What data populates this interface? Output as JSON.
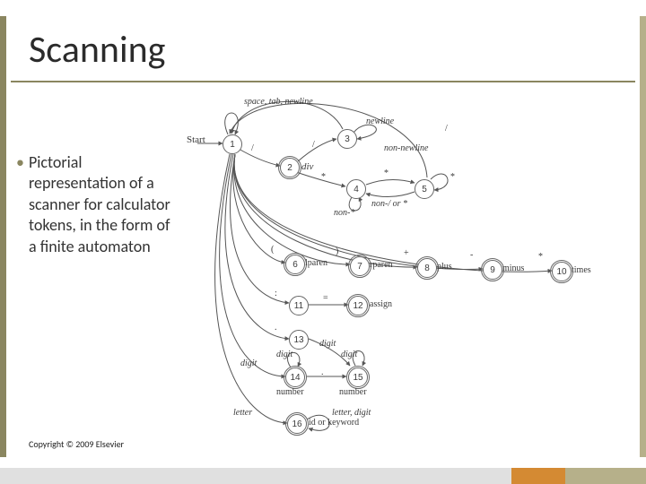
{
  "title": "Scanning",
  "bullet": "Pictorial representation of a scanner for calculator tokens, in the form of a finite automaton",
  "copyright": "Copyright © 2009 Elsevier",
  "diagram": {
    "start_label": "Start",
    "states": {
      "s1": {
        "num": "1",
        "final": false
      },
      "s2": {
        "num": "2",
        "final": true,
        "name": "div"
      },
      "s3": {
        "num": "3",
        "final": false
      },
      "s4": {
        "num": "4",
        "final": false
      },
      "s5": {
        "num": "5",
        "final": false
      },
      "s6": {
        "num": "6",
        "final": true,
        "name": "lparen"
      },
      "s7": {
        "num": "7",
        "final": true,
        "name": "rparen"
      },
      "s8": {
        "num": "8",
        "final": true,
        "name": "plus"
      },
      "s9": {
        "num": "9",
        "final": true,
        "name": "minus"
      },
      "s10": {
        "num": "10",
        "final": true,
        "name": "times"
      },
      "s11": {
        "num": "11",
        "final": false
      },
      "s12": {
        "num": "12",
        "final": true,
        "name": "assign"
      },
      "s13": {
        "num": "13",
        "final": false
      },
      "s14": {
        "num": "14",
        "final": true,
        "name": "number"
      },
      "s15": {
        "num": "15",
        "final": true,
        "name": "number"
      },
      "s16": {
        "num": "16",
        "final": true,
        "name": "id or keyword"
      }
    },
    "edge_text": {
      "self1": "space, tab, newline",
      "to3": "newline",
      "to5": "non-newline",
      "star": "*",
      "nonstar": "non-*",
      "nonslash": "non-/ or *",
      "slash": "/",
      "lparen": "(",
      "rparen": ")",
      "plus": "+",
      "minus": "-",
      "times": "*",
      "colon": ":",
      "eq": "=",
      "dot": ".",
      "digit": "digit",
      "letter": "letter",
      "letter_digit": "letter, digit"
    }
  }
}
